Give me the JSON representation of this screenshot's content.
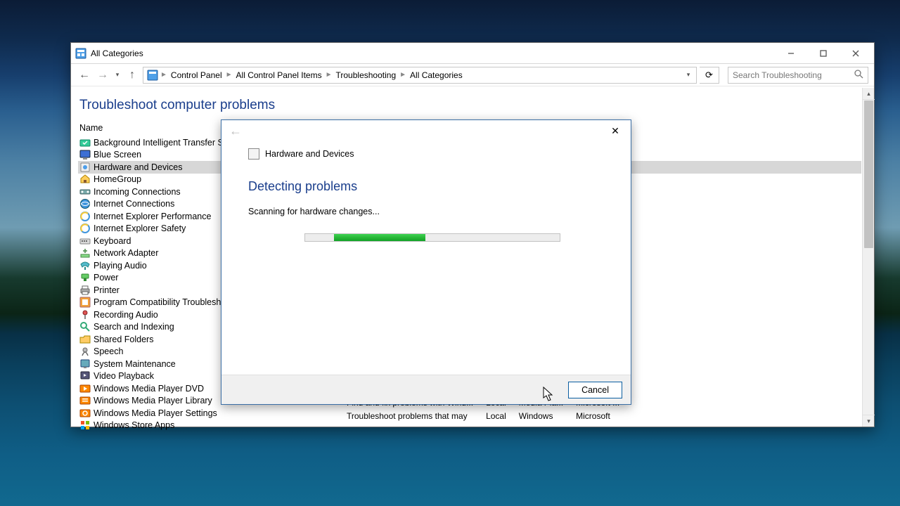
{
  "window": {
    "title": "All Categories",
    "breadcrumbs": [
      "Control Panel",
      "All Control Panel Items",
      "Troubleshooting",
      "All Categories"
    ],
    "search_placeholder": "Search Troubleshooting"
  },
  "page": {
    "title": "Troubleshoot computer problems",
    "column_header": "Name"
  },
  "items": [
    {
      "label": "Background Intelligent Transfer Service"
    },
    {
      "label": "Blue Screen"
    },
    {
      "label": "Hardware and Devices",
      "selected": true
    },
    {
      "label": "HomeGroup"
    },
    {
      "label": "Incoming Connections"
    },
    {
      "label": "Internet Connections"
    },
    {
      "label": "Internet Explorer Performance"
    },
    {
      "label": "Internet Explorer Safety"
    },
    {
      "label": "Keyboard"
    },
    {
      "label": "Network Adapter"
    },
    {
      "label": "Playing Audio"
    },
    {
      "label": "Power"
    },
    {
      "label": "Printer"
    },
    {
      "label": "Program Compatibility Troubleshooter"
    },
    {
      "label": "Recording Audio"
    },
    {
      "label": "Search and Indexing"
    },
    {
      "label": "Shared Folders"
    },
    {
      "label": "Speech"
    },
    {
      "label": "System Maintenance"
    },
    {
      "label": "Video Playback"
    },
    {
      "label": "Windows Media Player DVD"
    },
    {
      "label": "Windows Media Player Library"
    },
    {
      "label": "Windows Media Player Settings"
    },
    {
      "label": "Windows Store Apps"
    }
  ],
  "partial": {
    "r1": {
      "desc": "Find and fix problems with Wind...",
      "loc": "Local",
      "cat": "Media Pla...",
      "pub": "Microsoft ..."
    },
    "r2": {
      "desc": "Troubleshoot problems that may",
      "loc": "Local",
      "cat": "Windows",
      "pub": "Microsoft"
    }
  },
  "dialog": {
    "header": "Hardware and Devices",
    "status_title": "Detecting problems",
    "status_msg": "Scanning for hardware changes...",
    "cancel": "Cancel"
  }
}
